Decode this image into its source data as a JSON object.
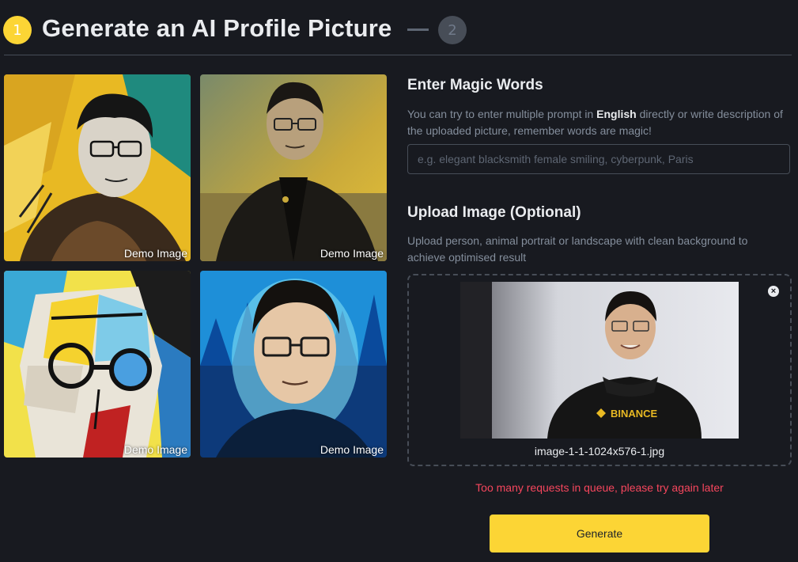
{
  "header": {
    "step1_number": "1",
    "title": "Generate an AI Profile Picture",
    "step2_number": "2"
  },
  "demo_images": [
    {
      "label": "Demo Image"
    },
    {
      "label": "Demo Image"
    },
    {
      "label": "Demo Image"
    },
    {
      "label": "Demo Image"
    }
  ],
  "magic_words": {
    "title": "Enter Magic Words",
    "help_prefix": "You can try to enter multiple prompt in ",
    "help_bold": "English",
    "help_suffix": " directly or write description of the uploaded picture, remember words are magic!",
    "placeholder": "e.g. elegant blacksmith female smiling, cyberpunk, Paris",
    "value": ""
  },
  "upload": {
    "title": "Upload Image (Optional)",
    "help": "Upload person, animal portrait or landscape with clean background to achieve optimised result",
    "filename": "image-1-1-1024x576-1.jpg",
    "preview_brand": "BINANCE",
    "remove_icon": "close-circle-icon"
  },
  "error_message": "Too many requests in queue, please try again later",
  "generate_label": "Generate",
  "colors": {
    "accent": "#fcd535",
    "background": "#181a20",
    "error": "#f6465d",
    "muted": "#848e9c"
  }
}
